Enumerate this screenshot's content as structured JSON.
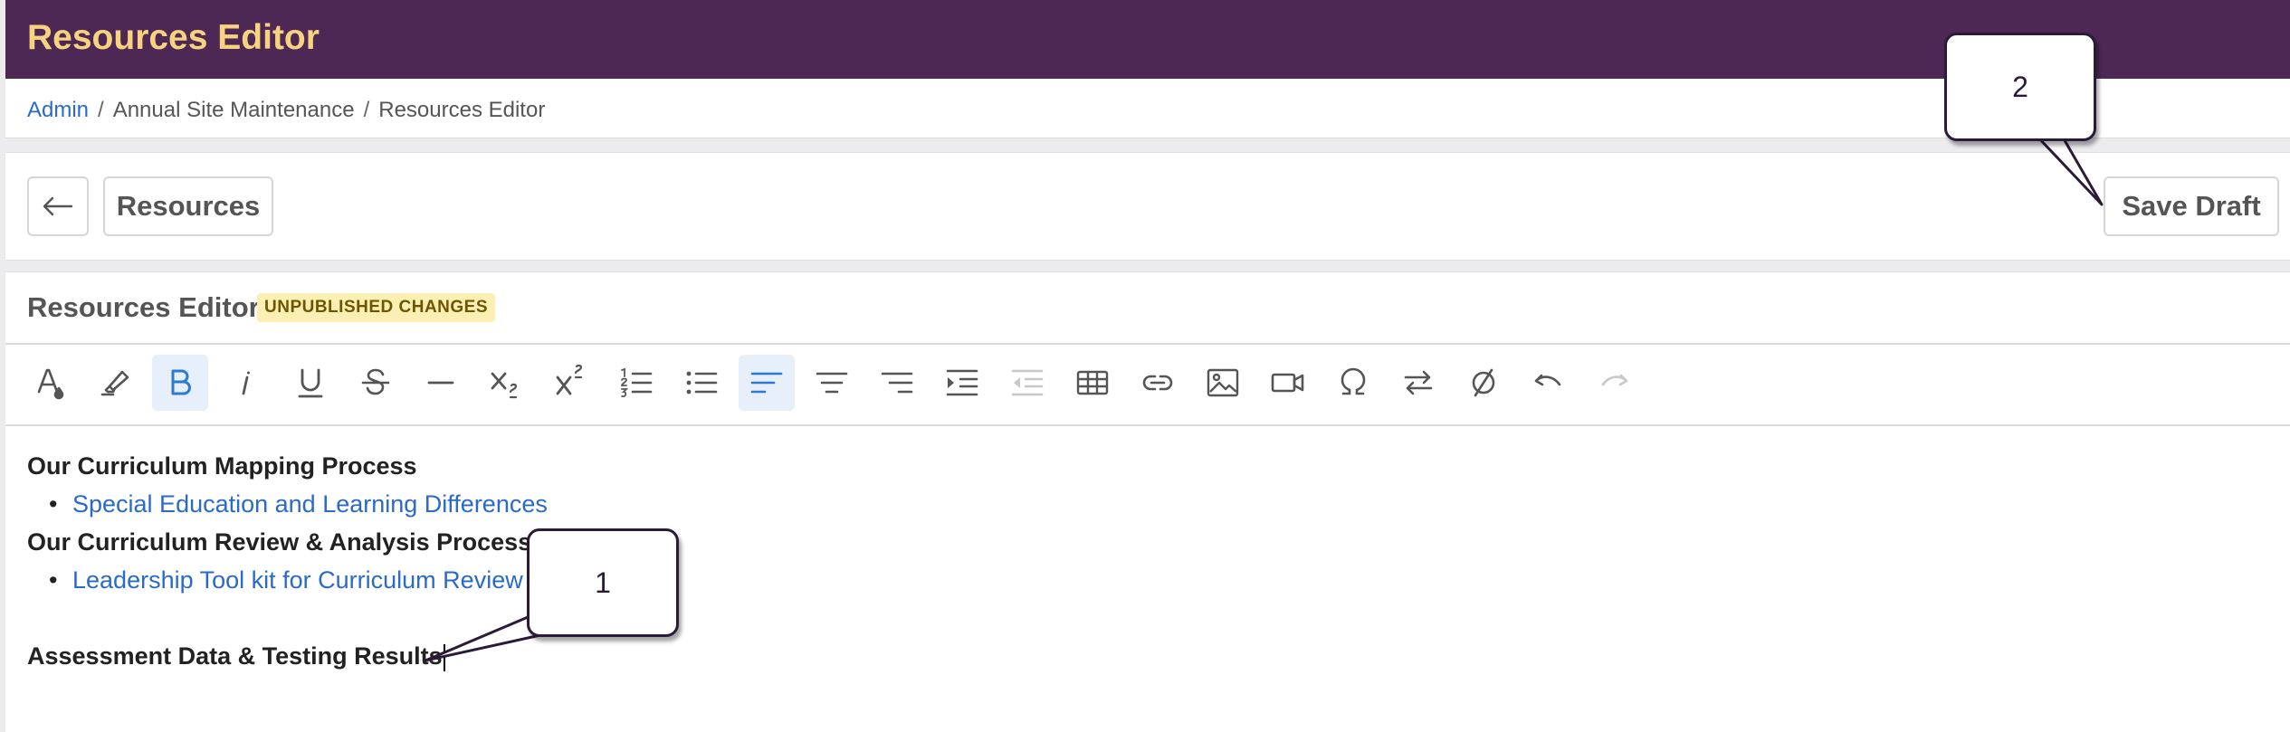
{
  "app": {
    "title": "Resources Editor"
  },
  "breadcrumb": {
    "items": [
      "Admin",
      "Annual Site Maintenance",
      "Resources Editor"
    ],
    "separator": "/"
  },
  "toolbar": {
    "back_icon": "arrow-left-icon",
    "resources_label": "Resources",
    "save_draft_label": "Save Draft"
  },
  "editor": {
    "title": "Resources Editor",
    "badge": "UNPUBLISHED CHANGES",
    "format_buttons": [
      {
        "name": "text-color-icon",
        "state": "normal"
      },
      {
        "name": "highlight-icon",
        "state": "normal"
      },
      {
        "name": "bold-icon",
        "state": "active"
      },
      {
        "name": "italic-icon",
        "state": "normal"
      },
      {
        "name": "underline-icon",
        "state": "normal"
      },
      {
        "name": "strikethrough-icon",
        "state": "normal"
      },
      {
        "name": "horizontal-rule-icon",
        "state": "normal"
      },
      {
        "name": "subscript-icon",
        "state": "normal"
      },
      {
        "name": "superscript-icon",
        "state": "normal"
      },
      {
        "name": "ordered-list-icon",
        "state": "normal"
      },
      {
        "name": "bullet-list-icon",
        "state": "normal"
      },
      {
        "name": "align-left-icon",
        "state": "active"
      },
      {
        "name": "align-center-icon",
        "state": "normal"
      },
      {
        "name": "align-right-icon",
        "state": "normal"
      },
      {
        "name": "indent-icon",
        "state": "normal"
      },
      {
        "name": "outdent-icon",
        "state": "disabled"
      },
      {
        "name": "table-icon",
        "state": "normal"
      },
      {
        "name": "link-icon",
        "state": "normal"
      },
      {
        "name": "image-icon",
        "state": "normal"
      },
      {
        "name": "video-icon",
        "state": "normal"
      },
      {
        "name": "special-character-icon",
        "state": "normal"
      },
      {
        "name": "text-direction-icon",
        "state": "normal"
      },
      {
        "name": "clear-formatting-icon",
        "state": "normal"
      },
      {
        "name": "undo-icon",
        "state": "normal"
      },
      {
        "name": "redo-icon",
        "state": "disabled"
      }
    ],
    "content": {
      "heading1": "Our Curriculum Mapping Process",
      "link1": "Special Education and Learning Differences",
      "heading2": "Our Curriculum Review & Analysis Process",
      "link2": "Leadership Tool kit for Curriculum Review",
      "heading3": "Assessment Data & Testing Results"
    }
  },
  "annotations": {
    "callout1": "1",
    "callout2": "2"
  },
  "colors": {
    "header_bg": "#4d2855",
    "header_title": "#f7d37f",
    "link": "#2a6ac8",
    "badge_bg": "#fbefb3",
    "active_blue": "#2a7bd1"
  }
}
